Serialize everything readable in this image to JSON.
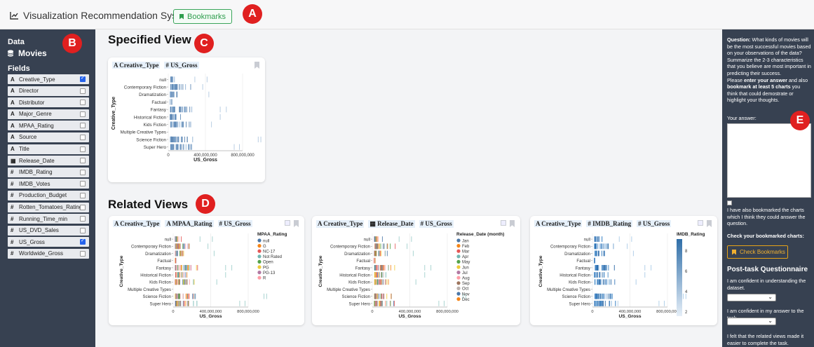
{
  "header": {
    "title": "Visualization Recommendation System",
    "bookmarks_label": "Bookmarks"
  },
  "markers": [
    "A",
    "B",
    "C",
    "D",
    "E"
  ],
  "sidebar": {
    "data_label": "Data",
    "dataset": "Movies",
    "fields_label": "Fields",
    "fields": [
      {
        "type": "A",
        "name": "Creative_Type",
        "checked": true
      },
      {
        "type": "A",
        "name": "Director",
        "checked": false
      },
      {
        "type": "A",
        "name": "Distributor",
        "checked": false
      },
      {
        "type": "A",
        "name": "Major_Genre",
        "checked": false
      },
      {
        "type": "A",
        "name": "MPAA_Rating",
        "checked": false
      },
      {
        "type": "A",
        "name": "Source",
        "checked": false
      },
      {
        "type": "A",
        "name": "Title",
        "checked": false
      },
      {
        "type": "▦",
        "name": "Release_Date",
        "checked": false
      },
      {
        "type": "#",
        "name": "IMDB_Rating",
        "checked": false
      },
      {
        "type": "#",
        "name": "IMDB_Votes",
        "checked": false
      },
      {
        "type": "#",
        "name": "Production_Budget",
        "checked": false
      },
      {
        "type": "#",
        "name": "Rotten_Tomatoes_Rating",
        "checked": false
      },
      {
        "type": "#",
        "name": "Running_Time_min",
        "checked": false
      },
      {
        "type": "#",
        "name": "US_DVD_Sales",
        "checked": false
      },
      {
        "type": "#",
        "name": "US_Gross",
        "checked": true
      },
      {
        "type": "#",
        "name": "Worldwide_Gross",
        "checked": false
      }
    ]
  },
  "specified": {
    "title": "Specified View",
    "encodings": [
      "A Creative_Type",
      "# US_Gross"
    ]
  },
  "related": {
    "title": "Related Views",
    "cards": [
      {
        "encodings": [
          "A Creative_Type",
          "A MPAA_Rating",
          "# US_Gross"
        ],
        "legend_title": "MPAA_Rating"
      },
      {
        "encodings": [
          "A Creative_Type",
          "▦ Release_Date",
          "# US_Gross"
        ],
        "legend_title": "Release_Date (month)"
      },
      {
        "encodings": [
          "A Creative_Type",
          "# IMDB_Rating",
          "# US_Gross"
        ],
        "legend_title": "IMDB_Rating"
      }
    ]
  },
  "chart_data": [
    {
      "type": "scatter",
      "mark": "tick",
      "ylabel": "Creative_Type",
      "xlabel": "US_Gross",
      "categories": [
        "null",
        "Contemporary Fiction",
        "Dramatization",
        "Factual",
        "Fantasy",
        "Historical Fiction",
        "Kids Fiction",
        "Multiple Creative Types",
        "Science Fiction",
        "Super Hero"
      ],
      "x_ticks": [
        "0",
        "400,000,000",
        "800,000,000"
      ],
      "xlim": [
        0,
        800000000
      ]
    },
    {
      "type": "scatter",
      "mark": "tick",
      "color_field": "MPAA_Rating",
      "legend": [
        {
          "label": "null",
          "color": "#4c78a8"
        },
        {
          "label": "G",
          "color": "#f58518"
        },
        {
          "label": "NC-17",
          "color": "#e45756"
        },
        {
          "label": "Not Rated",
          "color": "#72b7b2"
        },
        {
          "label": "Open",
          "color": "#54a24b"
        },
        {
          "label": "PG",
          "color": "#eeca3b"
        },
        {
          "label": "PG-13",
          "color": "#b279a2"
        },
        {
          "label": "R",
          "color": "#ff9da6"
        }
      ]
    },
    {
      "type": "scatter",
      "mark": "tick",
      "color_field": "Release_Date (month)",
      "legend": [
        {
          "label": "Jan",
          "color": "#4c78a8"
        },
        {
          "label": "Feb",
          "color": "#f58518"
        },
        {
          "label": "Mar",
          "color": "#e45756"
        },
        {
          "label": "Apr",
          "color": "#72b7b2"
        },
        {
          "label": "May",
          "color": "#54a24b"
        },
        {
          "label": "Jun",
          "color": "#eeca3b"
        },
        {
          "label": "Jul",
          "color": "#b279a2"
        },
        {
          "label": "Aug",
          "color": "#ff9da6"
        },
        {
          "label": "Sep",
          "color": "#9d755d"
        },
        {
          "label": "Oct",
          "color": "#bab0ac"
        },
        {
          "label": "Nov",
          "color": "#4c78a8"
        },
        {
          "label": "Dec",
          "color": "#f58518"
        }
      ]
    },
    {
      "type": "scatter",
      "mark": "tick",
      "color_field": "IMDB_Rating",
      "gradient_ticks": [
        "8",
        "6",
        "4",
        "2"
      ]
    }
  ],
  "right_panel": {
    "question_label": "Question:",
    "question_text": " What kinds of movies will be the most successful movies based on your observations of the data? Summarize the 2-3 characteristics that you believe are most important in predicting their success.",
    "instruction_pre": "Please ",
    "instruction_bold1": "enter your answer",
    "instruction_mid": " and also ",
    "instruction_bold2": "bookmark at least 5 charts",
    "instruction_post": " you think that could demostrate or highlight your thoughts.",
    "answer_label": "Your answer:",
    "bookmark_confirm": "I have also bookmarked the charts which I think they could answer the question.",
    "check_label": "Check your bookmarked charts:",
    "check_button": "Check Bookmarks",
    "post_title": "Post-task Questionnaire",
    "q1": "I am confident in understanding the dataset.",
    "q2": "I am confident in my answer to the task.",
    "q3": "I felt that the related views made it easier to complete the task."
  }
}
